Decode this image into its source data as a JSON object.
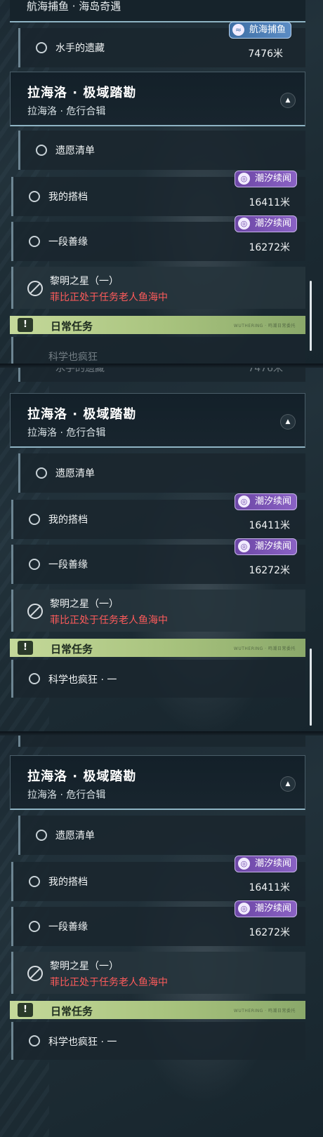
{
  "group_header": {
    "title": "拉海洛 · 极域踏勘",
    "subtitle": "拉海洛 · 危行合辑"
  },
  "top_partial": {
    "category": "航海捕鱼 · 海岛奇遇",
    "task": {
      "name": "水手的遗藏",
      "distance": "7476米",
      "badge": "航海捕鱼"
    }
  },
  "tasks": {
    "wish_list": {
      "name": "遗愿清单"
    },
    "partner": {
      "name": "我的搭档",
      "distance": "16411米",
      "badge": "潮汐续闻"
    },
    "good_fate": {
      "name": "一段善缘",
      "distance": "16272米",
      "badge": "潮汐续闻"
    },
    "morning_star": {
      "name": "黎明之星（一）",
      "status": "菲比正处于任务老人鱼海中"
    }
  },
  "daily": {
    "label": "日常任务",
    "icon_text": "!",
    "tag": "WUTHERING · 鸣潮日常委托",
    "task": "科学也疯狂 · 一",
    "ghost_task": "科学也疯狂"
  },
  "ghost_prev": {
    "name": "水手的遗藏",
    "distance": "7476米"
  },
  "icons": {
    "badge_partner": "wave-spiral-icon",
    "badge_fishing": "fishing-icon",
    "collapse": "chevron-up-icon",
    "daily": "exclamation-icon"
  },
  "colors": {
    "badge_purple": "#7a52b5",
    "badge_blue": "#4a7cb5",
    "warning_red": "#ff5b5b",
    "daily_green": "#b8d08a",
    "header_accent": "#8fb4c4"
  }
}
